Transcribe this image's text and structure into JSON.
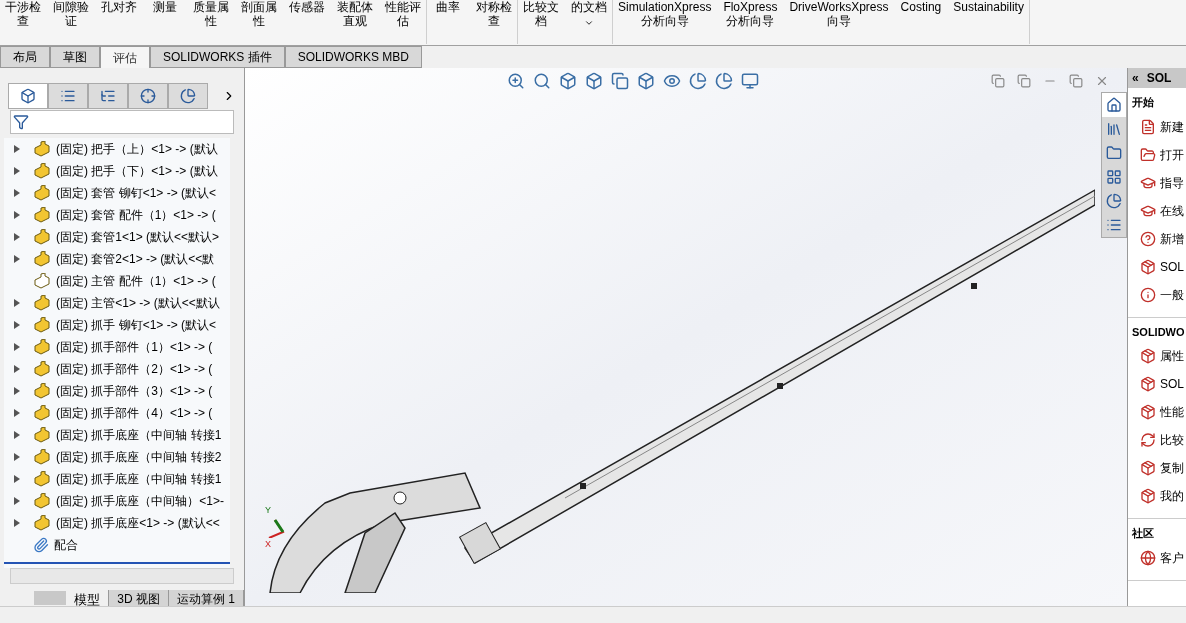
{
  "ribbon": {
    "groups": [
      {
        "items": [
          {
            "lines": [
              "干涉检",
              "查"
            ]
          },
          {
            "lines": [
              "间隙验",
              "证"
            ]
          },
          {
            "lines": [
              "孔对齐"
            ]
          },
          {
            "lines": [
              "测量"
            ]
          },
          {
            "lines": [
              "质量属",
              "性"
            ]
          },
          {
            "lines": [
              "剖面属",
              "性"
            ]
          },
          {
            "lines": [
              "传感器"
            ]
          },
          {
            "lines": [
              "装配体",
              "直观"
            ]
          },
          {
            "lines": [
              "性能评",
              "估"
            ]
          }
        ]
      },
      {
        "items": [
          {
            "lines": [
              "曲率"
            ]
          },
          {
            "lines": [
              "对称检",
              "查"
            ]
          }
        ]
      },
      {
        "items": [
          {
            "lines": [
              "比较文",
              "档"
            ]
          },
          {
            "lines": [
              "的文档"
            ],
            "dropdown": true
          }
        ]
      },
      {
        "items": [
          {
            "lines": [
              "SimulationXpress",
              "分析向导"
            ]
          },
          {
            "lines": [
              "FloXpress",
              "分析向导"
            ]
          },
          {
            "lines": [
              "DriveWorksXpress",
              "向导"
            ]
          },
          {
            "lines": [
              "Costing"
            ]
          },
          {
            "lines": [
              "Sustainability"
            ]
          }
        ]
      }
    ]
  },
  "tabs": [
    {
      "label": "布局",
      "selected": false
    },
    {
      "label": "草图",
      "selected": false
    },
    {
      "label": "评估",
      "selected": true
    },
    {
      "label": "SOLIDWORKS 插件",
      "selected": false
    },
    {
      "label": "SOLIDWORKS MBD",
      "selected": false
    }
  ],
  "manager_tabs": [
    {
      "kind": "feature",
      "selected": true
    },
    {
      "kind": "property",
      "selected": false
    },
    {
      "kind": "config",
      "selected": false
    },
    {
      "kind": "dimxpert",
      "selected": false
    },
    {
      "kind": "display",
      "selected": false
    }
  ],
  "tree": [
    {
      "text": "(固定) 把手（上）<1> -> (默认",
      "kind": "part"
    },
    {
      "text": "(固定) 把手（下）<1> -> (默认",
      "kind": "part"
    },
    {
      "text": "(固定) 套管  铆钉<1> -> (默认<",
      "kind": "part"
    },
    {
      "text": "(固定) 套管  配件（1）<1> -> (",
      "kind": "part"
    },
    {
      "text": "(固定) 套管1<1> (默认<<默认>",
      "kind": "part"
    },
    {
      "text": "(固定) 套管2<1> -> (默认<<默",
      "kind": "part"
    },
    {
      "text": "(固定) 主管  配件（1）<1> -> (",
      "kind": "hidden-part"
    },
    {
      "text": "(固定) 主管<1> -> (默认<<默认",
      "kind": "part"
    },
    {
      "text": "(固定) 抓手  铆钉<1> -> (默认<",
      "kind": "part"
    },
    {
      "text": "(固定) 抓手部件（1）<1> -> (",
      "kind": "part"
    },
    {
      "text": "(固定) 抓手部件（2）<1> -> (",
      "kind": "part"
    },
    {
      "text": "(固定) 抓手部件（3）<1> -> (",
      "kind": "part"
    },
    {
      "text": "(固定) 抓手部件（4）<1> -> (",
      "kind": "part"
    },
    {
      "text": "(固定) 抓手底座（中间轴  转接1",
      "kind": "part"
    },
    {
      "text": "(固定) 抓手底座（中间轴  转接2",
      "kind": "part"
    },
    {
      "text": "(固定) 抓手底座（中间轴 转接1",
      "kind": "part"
    },
    {
      "text": "(固定) 抓手底座（中间轴）<1>-",
      "kind": "part"
    },
    {
      "text": "(固定) 抓手底座<1> -> (默认<<",
      "kind": "part"
    },
    {
      "text": "配合",
      "kind": "mates"
    }
  ],
  "bottom_tabs": [
    {
      "label": "模型",
      "selected": true
    },
    {
      "label": "3D 视图",
      "selected": false
    },
    {
      "label": "运动算例 1",
      "selected": false
    }
  ],
  "triad": {
    "y": "Y",
    "x": "X"
  },
  "task_pane": {
    "collapse": "«",
    "title": "SOL",
    "tabs": [
      {
        "kind": "home",
        "selected": true
      },
      {
        "kind": "library",
        "selected": false
      },
      {
        "kind": "folder",
        "selected": false
      },
      {
        "kind": "palette",
        "selected": false
      },
      {
        "kind": "appearance",
        "selected": false
      },
      {
        "kind": "properties",
        "selected": false
      }
    ],
    "sections": [
      {
        "title": "开始",
        "items": [
          {
            "kind": "doc",
            "text": "新建"
          },
          {
            "kind": "open",
            "text": "打开"
          },
          {
            "kind": "cap",
            "text": "指导"
          },
          {
            "kind": "cap",
            "text": "在线"
          },
          {
            "kind": "help",
            "text": "新增"
          },
          {
            "kind": "sw",
            "text": "SOL"
          },
          {
            "kind": "info",
            "text": "一般"
          }
        ]
      },
      {
        "title": "SOLIDWO",
        "items": [
          {
            "kind": "sw",
            "text": "属性"
          },
          {
            "kind": "sw",
            "text": "SOL"
          },
          {
            "kind": "sw",
            "text": "性能"
          },
          {
            "kind": "compare",
            "text": "比较"
          },
          {
            "kind": "sw",
            "text": "复制"
          },
          {
            "kind": "sw",
            "text": "我的"
          }
        ]
      },
      {
        "title": "社区",
        "items": [
          {
            "kind": "globe",
            "text": "客户"
          }
        ]
      }
    ]
  }
}
